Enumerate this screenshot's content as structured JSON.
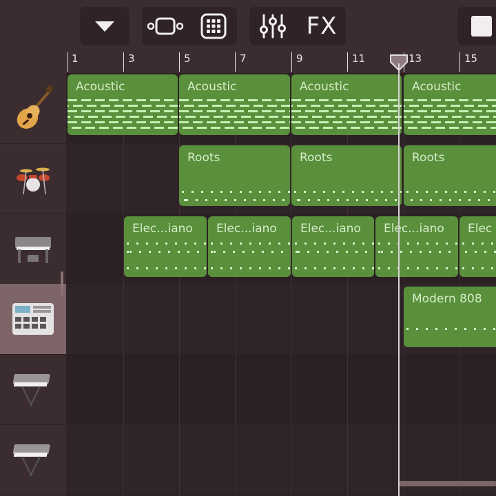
{
  "toolbar": {
    "fx_label": "FX"
  },
  "ruler": {
    "bars": [
      "1",
      "3",
      "5",
      "7",
      "9",
      "11",
      "13",
      "15"
    ]
  },
  "tracks": [
    {
      "icon": "acoustic-guitar-icon"
    },
    {
      "icon": "drum-kit-icon"
    },
    {
      "icon": "electric-piano-icon"
    },
    {
      "icon": "beat-sequencer-icon",
      "selected": true
    },
    {
      "icon": "synth-keyboard-icon"
    },
    {
      "icon": "synth-keyboard-icon"
    }
  ],
  "regions": {
    "acoustic": [
      "Acoustic",
      "Acoustic",
      "Acoustic",
      "Acoustic"
    ],
    "roots": [
      "Roots",
      "Roots",
      "Roots"
    ],
    "epiano": [
      "Elec...iano",
      "Elec...iano",
      "Elec...iano",
      "Elec...iano",
      "Elec"
    ],
    "modern808": [
      "Modern 808"
    ]
  },
  "colors": {
    "region_green": "#5a8f3c",
    "region_text": "#d5ecc7",
    "background": "#2a1f22",
    "toolbar": "#3b2c30"
  }
}
